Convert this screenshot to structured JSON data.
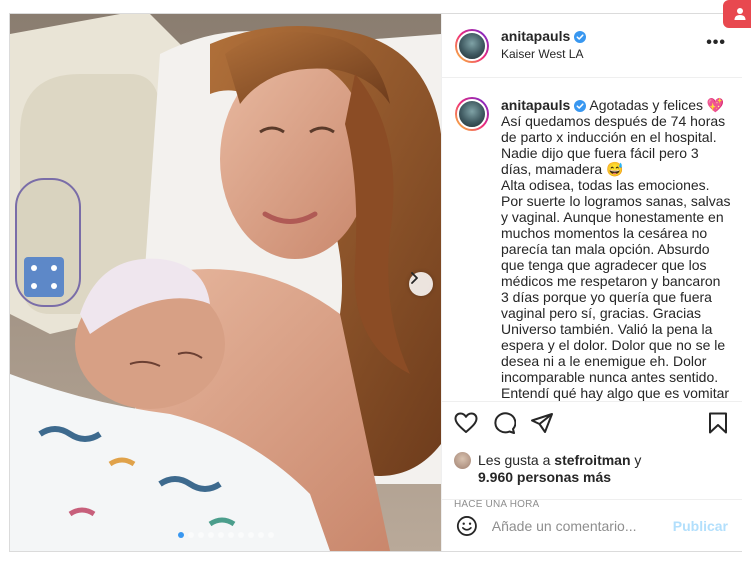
{
  "post": {
    "username": "anitapauls",
    "location": "Kaiser West LA",
    "caption": "Agotadas y felices 💖\nAsí quedamos después de 74 horas de parto x inducción en el hospital. Nadie dijo que fuera fácil pero 3 días, mamadera 😅\nAlta odisea, todas las emociones. Por suerte lo logramos sanas, salvas y vaginal. Aunque honestamente en muchos momentos la cesárea no parecía tan mala opción. Absurdo que tenga que agradecer que los médicos me respetaron y bancaron 3 días porque yo quería que fuera vaginal pero sí, gracias. Gracias Universo también. Valió la pena la espera y el dolor. Dolor que no se le desea ni a le enemigue eh. Dolor incomparable nunca antes sentido. Entendí qué hay algo que es vomitar de dolor.",
    "likes_prefix": "Les gusta a",
    "liked_by": "stefroitman",
    "likes_join": "y",
    "likes_count": "9.960 personas más",
    "timestamp": "Hace una hora",
    "comment_placeholder": "Añade un comentario...",
    "publish_label": "Publicar"
  },
  "carousel": {
    "total_slides": 10,
    "active_slide": 1
  },
  "icons": {
    "verified": "verified-badge-icon",
    "more": "more-options-icon",
    "like": "heart-icon",
    "comment": "comment-icon",
    "share": "share-icon",
    "save": "bookmark-icon",
    "emoji": "smiley-icon",
    "next": "chevron-right-icon",
    "profile": "user-icon"
  },
  "colors": {
    "verified": "#3897f0",
    "publish_disabled": "#b2dffc",
    "border": "#dbdbdb",
    "badge": "#e8484f"
  }
}
